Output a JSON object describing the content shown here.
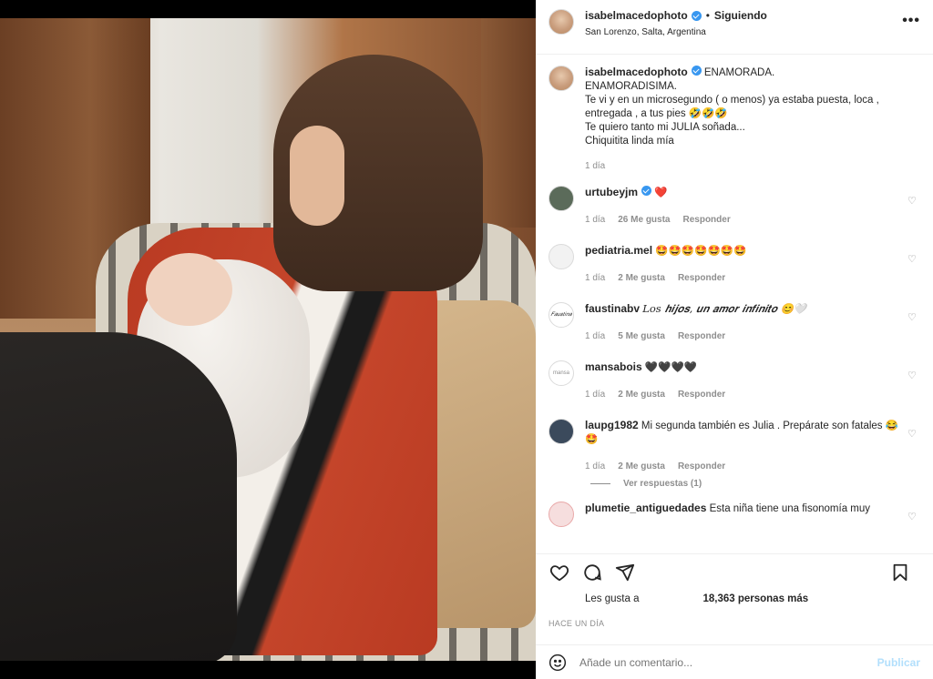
{
  "post": {
    "username": "isabelmacedophoto",
    "follow_state": "Siguiendo",
    "separator": "•",
    "location": "San Lorenzo, Salta, Argentina",
    "more": "•••"
  },
  "caption": {
    "username": "isabelmacedophoto",
    "lines": [
      "ENAMORADA.",
      "ENAMORADISIMA.",
      "Te vi y en un microsegundo ( o menos) ya estaba puesta, loca ,",
      "entregada , a tus pies 🤣🤣🤣",
      "Te quiero tanto mi JULIA soñada...",
      "Chiquitita linda mía"
    ],
    "time": "1 día"
  },
  "comments": [
    {
      "username": "urtubeyjm",
      "text": "❤️",
      "time": "1 día",
      "likes": "26 Me gusta",
      "reply": "Responder",
      "avatar_color": "#5b6b5a"
    },
    {
      "username": "pediatria.mel",
      "text": "🤩🤩🤩🤩🤩🤩🤩",
      "time": "1 día",
      "likes": "2 Me gusta",
      "reply": "Responder",
      "avatar_color": "#f2f2f2"
    },
    {
      "username": "faustinabv",
      "text": "𝐿𝑜𝑠 𝒉𝒊𝒋𝒐𝒔, 𝒖𝒏 𝒂𝒎𝒐𝒓 𝒊𝒏𝒇𝒊𝒏𝒊𝒕𝒐 😊🤍",
      "time": "1 día",
      "likes": "5 Me gusta",
      "reply": "Responder",
      "avatar_color": "#ffffff",
      "avatar_text": "𝐹𝑎𝑢𝑠𝑡𝑖𝑛𝑎"
    },
    {
      "username": "mansabois",
      "text": "🖤🖤🖤🖤",
      "time": "1 día",
      "likes": "2 Me gusta",
      "reply": "Responder",
      "avatar_color": "#ffffff",
      "avatar_text": "mansa"
    },
    {
      "username": "laupg1982",
      "text": "Mi segunda también es Julia . Prepárate son fatales 😂🤩",
      "time": "1 día",
      "likes": "2 Me gusta",
      "reply": "Responder",
      "avatar_color": "#3b4a5c"
    },
    {
      "username": "plumetie_antiguedades",
      "text": "Esta niña tiene una fisonomía muy",
      "avatar_color": "#e9a9a9"
    }
  ],
  "replies": "Ver respuestas (1)",
  "actions": {
    "like": "heart-icon",
    "comment": "comment-icon",
    "share": "share-icon",
    "save": "bookmark-icon"
  },
  "likes": {
    "prefix": "Les gusta a",
    "count": "18,363 personas más"
  },
  "posted_ago": "HACE UN DÍA",
  "add_comment": {
    "placeholder": "Añade un comentario...",
    "publish": "Publicar"
  },
  "colors": {
    "verified": "#3897f0",
    "heart": "#ed4956",
    "publish_disabled": "#b2dffc",
    "muted": "#8e8e8e"
  }
}
